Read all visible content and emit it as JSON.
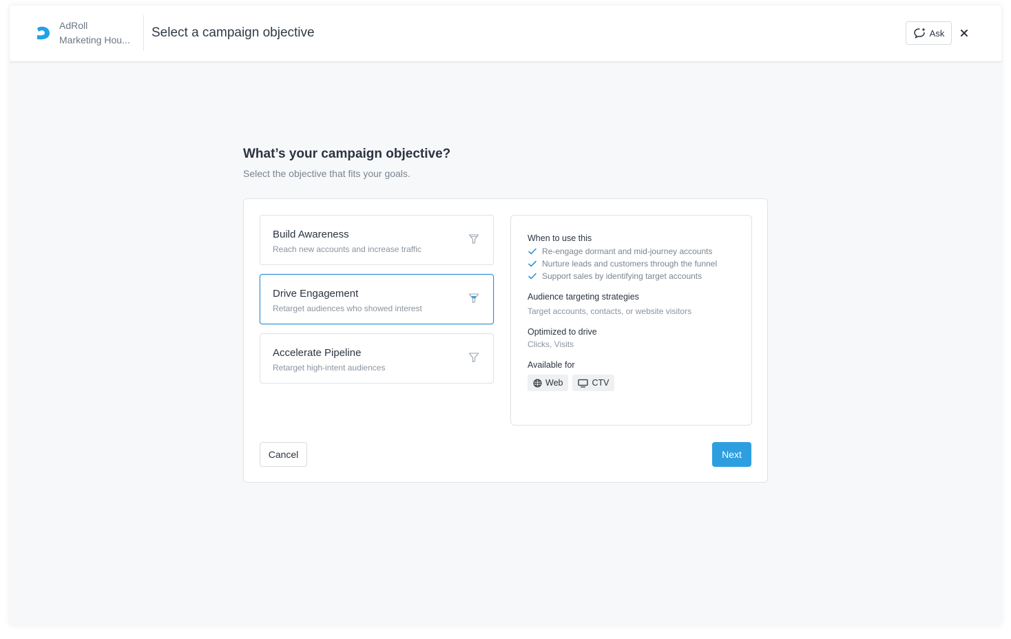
{
  "header": {
    "brand": "AdRoll",
    "org_name": "Marketing Hou...",
    "title": "Select a campaign objective",
    "ask_label": "Ask"
  },
  "main": {
    "heading": "What’s your campaign objective?",
    "subheading": "Select the objective that fits your goals."
  },
  "objectives": [
    {
      "title": "Build Awareness",
      "description": "Reach new accounts and increase traffic",
      "selected": false
    },
    {
      "title": "Drive Engagement",
      "description": "Retarget audiences who showed interest",
      "selected": true
    },
    {
      "title": "Accelerate Pipeline",
      "description": "Retarget high-intent audiences",
      "selected": false
    }
  ],
  "details": {
    "when_label": "When to use this",
    "when_items": [
      "Re-engage dormant and mid-journey accounts",
      "Nurture leads and customers through the funnel",
      "Support sales by identifying target accounts"
    ],
    "strategies_label": "Audience targeting strategies",
    "strategies_text": "Target accounts, contacts, or website visitors",
    "optimized_label": "Optimized to drive",
    "optimized_text": "Clicks, Visits",
    "available_label": "Available for",
    "channels": [
      {
        "label": "Web",
        "icon": "globe-icon"
      },
      {
        "label": "CTV",
        "icon": "monitor-icon"
      }
    ]
  },
  "actions": {
    "cancel_label": "Cancel",
    "next_label": "Next"
  },
  "colors": {
    "accent": "#2d9fe0",
    "selected_border": "#2a8fd4",
    "brand_logo": "#1fa3e8"
  }
}
